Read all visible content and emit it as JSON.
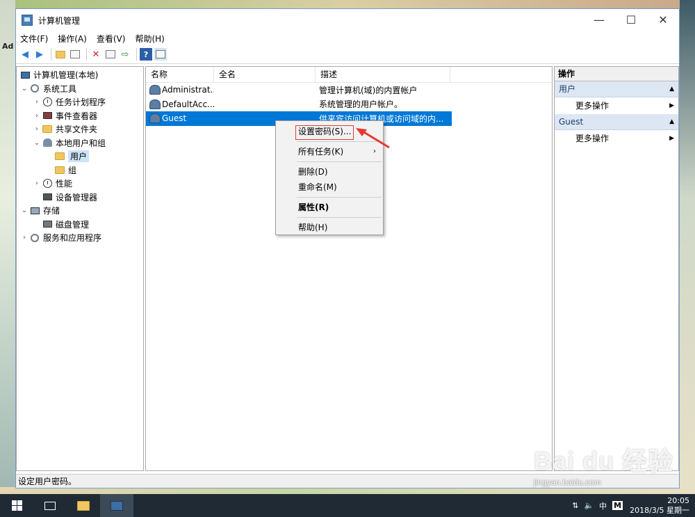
{
  "window": {
    "title": "计算机管理",
    "minimize": "—",
    "maximize": "☐",
    "close": "✕"
  },
  "menu": [
    "文件(F)",
    "操作(A)",
    "查看(V)",
    "帮助(H)"
  ],
  "desktop": {
    "left_label": "Ad"
  },
  "tree": [
    {
      "label": "计算机管理(本地)",
      "icon": "computer-management-icon",
      "arrow": ""
    },
    {
      "label": "系统工具",
      "icon": "tools-icon",
      "arrow": "⌄"
    },
    {
      "label": "任务计划程序",
      "icon": "clock-icon",
      "arrow": "›"
    },
    {
      "label": "事件查看器",
      "icon": "event-viewer-icon",
      "arrow": "›"
    },
    {
      "label": "共享文件夹",
      "icon": "shared-folder-icon",
      "arrow": "›"
    },
    {
      "label": "本地用户和组",
      "icon": "users-group-icon",
      "arrow": "⌄"
    },
    {
      "label": "用户",
      "icon": "folder-icon",
      "arrow": ""
    },
    {
      "label": "组",
      "icon": "folder-icon",
      "arrow": ""
    },
    {
      "label": "性能",
      "icon": "performance-icon",
      "arrow": "›"
    },
    {
      "label": "设备管理器",
      "icon": "device-manager-icon",
      "arrow": ""
    },
    {
      "label": "存储",
      "icon": "storage-icon",
      "arrow": "⌄"
    },
    {
      "label": "磁盘管理",
      "icon": "disk-icon",
      "arrow": ""
    },
    {
      "label": "服务和应用程序",
      "icon": "services-icon",
      "arrow": "›"
    }
  ],
  "list": {
    "columns": [
      "名称",
      "全名",
      "描述"
    ],
    "rows": [
      {
        "name": "Administrat...",
        "full": "",
        "desc": "管理计算机(域)的内置帐户"
      },
      {
        "name": "DefaultAcc...",
        "full": "",
        "desc": "系统管理的用户帐户。"
      },
      {
        "name": "Guest",
        "full": "",
        "desc": "供来宾访问计算机或访问域的内..."
      }
    ]
  },
  "context_menu": {
    "items": [
      "设置密码(S)...",
      "所有任务(K)",
      "删除(D)",
      "重命名(M)",
      "属性(R)",
      "帮助(H)"
    ],
    "submenu_arrow": "›"
  },
  "actions": {
    "title": "操作",
    "sections": [
      {
        "label": "用户",
        "item": "更多操作"
      },
      {
        "label": "Guest",
        "item": "更多操作"
      }
    ],
    "collapse_glyph": "▲",
    "more_glyph": "▶"
  },
  "status": "设定用户密码。",
  "taskbar": {
    "time": "20:05",
    "date": "2018/3/5 星期一",
    "ime": "中",
    "ime_mode": "M"
  },
  "watermark": {
    "brand": "Bai du 经验",
    "url": "jingyan.baidu.com"
  },
  "colors": {
    "selection": "#0078d7",
    "annotation": "#e53935",
    "taskbar": "#1f2a35"
  }
}
